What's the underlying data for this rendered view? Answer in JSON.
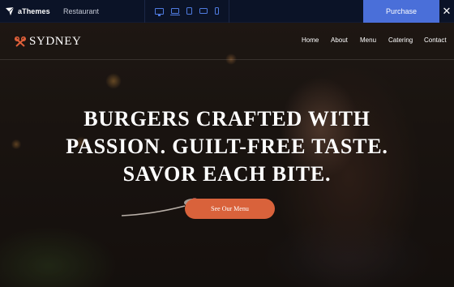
{
  "topbar": {
    "brand_name": "aThemes",
    "title": "Restaurant",
    "devices": [
      "desktop-icon",
      "laptop-icon",
      "tablet-icon",
      "tablet-landscape-icon",
      "phone-icon"
    ],
    "purchase_label": "Purchase",
    "close_label": "✕",
    "colors": {
      "bar": "#0b1327",
      "accent": "#4a6fd9"
    }
  },
  "site": {
    "logo_text": "SYDNEY",
    "nav": [
      "Home",
      "About",
      "Menu",
      "Catering",
      "Contact"
    ]
  },
  "hero": {
    "headline_lines": [
      "BURGERS CRAFTED WITH",
      "PASSION. GUILT-FREE TASTE.",
      "SAVOR EACH BITE."
    ],
    "cta_label": "See Our Menu",
    "colors": {
      "cta": "#d9623b",
      "logo_icon": "#e0603a"
    }
  }
}
